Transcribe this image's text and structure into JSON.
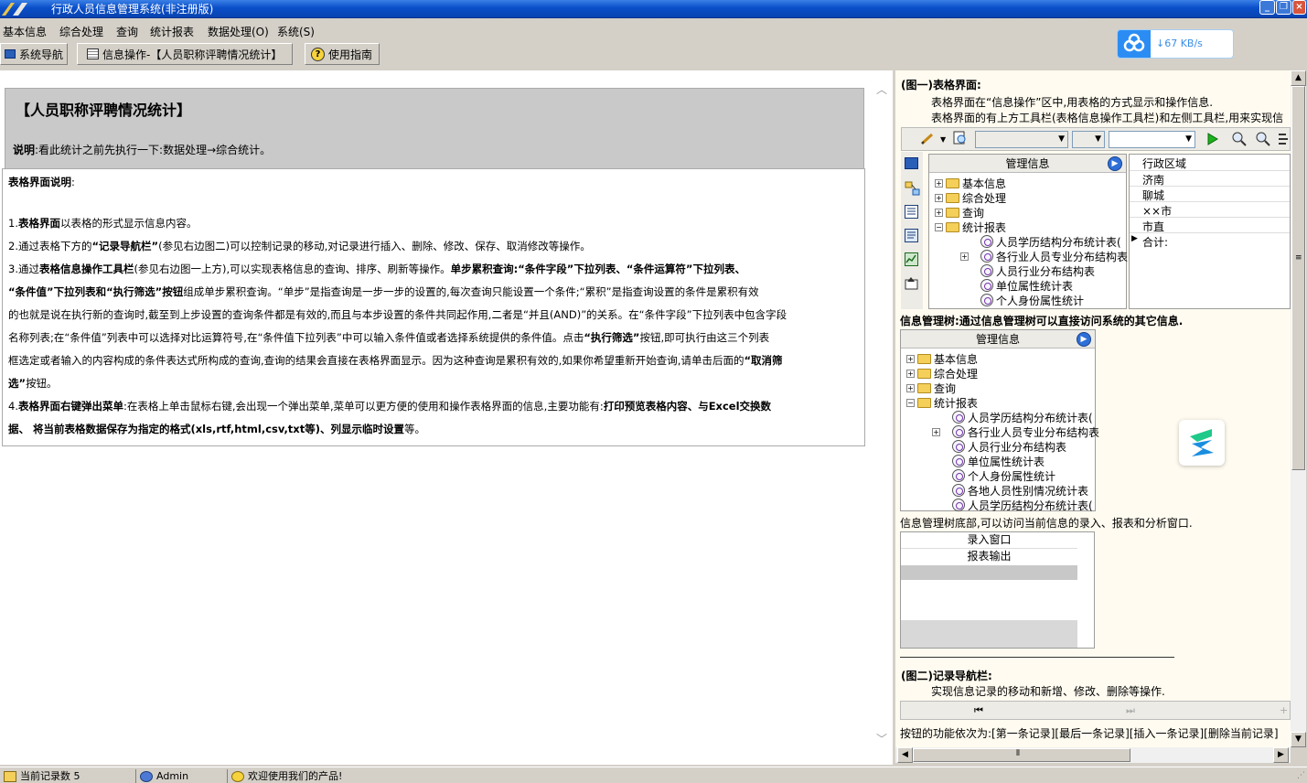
{
  "window": {
    "title": "行政人员信息管理系统(非注册版)"
  },
  "menubar": {
    "items": [
      "基本信息",
      "综合处理",
      "查询",
      "统计报表",
      "数据处理(O)",
      "系统(S)"
    ]
  },
  "toolbar": {
    "nav_label": "系统导航",
    "info_label": "信息操作-【人员职称评聘情况统计】",
    "guide_label": "使用指南"
  },
  "net_widget": {
    "speed": "↓67 KB/s"
  },
  "left": {
    "title": "【人员职称评聘情况统计】",
    "note_bold": "说明",
    "note_text": ":看此统计之前先执行一下:数据处理→综合统计。",
    "section_title": "表格界面说明",
    "section_colon": ":",
    "p1_num": "1.",
    "p1_bold": "表格界面",
    "p1_text": "以表格的形式显示信息内容。",
    "p2_text_a": "2.通过表格下方的",
    "p2_bold": "“记录导航栏”",
    "p2_text_b": "(参见右边图二)可以控制记录的移动,对记录进行插入、删除、修改、保存、取消修改等操作。",
    "p3_text_a": "3.通过",
    "p3_bold_a": "表格信息操作工具栏",
    "p3_text_b": "(参见右边图一上方),可以实现表格信息的查询、排序、刷新等操作。",
    "p3_bold_b": "单步累积查询:“条件字段”下拉列表、“条件运算符”下拉列表、",
    "p3_line2_bold": "“条件值”下拉列表和“执行筛选”按钮",
    "p3_line2_text": "组成单步累积查询。“单步”是指查询是一步一步的设置的,每次查询只能设置一个条件;“累积”是指查询设置的条件是累积有效",
    "p3_line3": "的也就是说在执行新的查询时,截至到上步设置的查询条件都是有效的,而且与本步设置的条件共同起作用,二者是“并且(AND)”的关系。在“条件字段”下拉列表中包含字段",
    "p3_line4_a": "名称列表;在“条件值”列表中可以选择对比运算符号,在“条件值下拉列表”中可以输入条件值或者选择系统提供的条件值。点击",
    "p3_line4_bold": "“执行筛选”",
    "p3_line4_b": "按钮,即可执行由这三个列表",
    "p3_line5_a": "框选定或者输入的内容构成的条件表达式所构成的查询,查询的结果会直接在表格界面显示。因为这种查询是累积有效的,如果你希望重新开始查询,请单击后面的",
    "p3_line5_bold": "“取消筛",
    "p3_line6_bold": "选”",
    "p3_line6_text": "按钮。",
    "p4_text_a": "4.",
    "p4_bold_a": "表格界面右键弹出菜单",
    "p4_text_b": ":在表格上单击鼠标右键,会出现一个弹出菜单,菜单可以更方便的使用和操作表格界面的信息,主要功能有:",
    "p4_bold_b": "打印预览表格内容、与Excel交换数",
    "p4_line2_bold_a": "据、  将当前表格数据保存为指定的格式(xls,rtf,html,csv,txt等)、列显示临时设置",
    "p4_line2_text": "等。"
  },
  "right": {
    "fig1_title": "(图一)表格界面:",
    "fig1_desc1": "表格界面在“信息操作”区中,用表格的方式显示和操作信息.",
    "fig1_desc2": "表格界面的有上方工具栏(表格信息操作工具栏)和左侧工具栏,用来实现信",
    "tree1": {
      "header": "管理信息",
      "rows": [
        "基本信息",
        "综合处理",
        "查询",
        "统计报表",
        "人员学历结构分布统计表(",
        "各行业人员专业分布结构表",
        "人员行业分布结构表",
        "单位属性统计表",
        "个人身份属性统计"
      ]
    },
    "grid1": {
      "header": "行政区域",
      "rows": [
        "济南",
        "聊城",
        "××市",
        "市直",
        "合计:"
      ]
    },
    "tree_caption_bold": "信息管理树:通过信息管理树可以直接访问系统的其它信息.",
    "tree2": {
      "header": "管理信息",
      "rows": [
        "基本信息",
        "综合处理",
        "查询",
        "统计报表",
        "人员学历结构分布统计表(",
        "各行业人员专业分布结构表",
        "人员行业分布结构表",
        "单位属性统计表",
        "个人身份属性统计",
        "各地人员性别情况统计表",
        "人员学历结构分布统计表("
      ]
    },
    "tree_bottom_caption": "信息管理树底部,可以访问当前信息的录入、报表和分析窗口.",
    "bottom_items": [
      "录入窗口",
      "报表输出"
    ],
    "fig2_title": "(图二)记录导航栏:",
    "fig2_desc": "实现信息记录的移动和新增、修改、删除等操作.",
    "nav_buttons_caption": "按钮的功能依次为:[第一条记录][最后一条记录][插入一条记录][删除当前记录]"
  },
  "status": {
    "record_count": "当前记录数 5",
    "user": "Admin",
    "welcome": "欢迎使用我们的产品!"
  }
}
